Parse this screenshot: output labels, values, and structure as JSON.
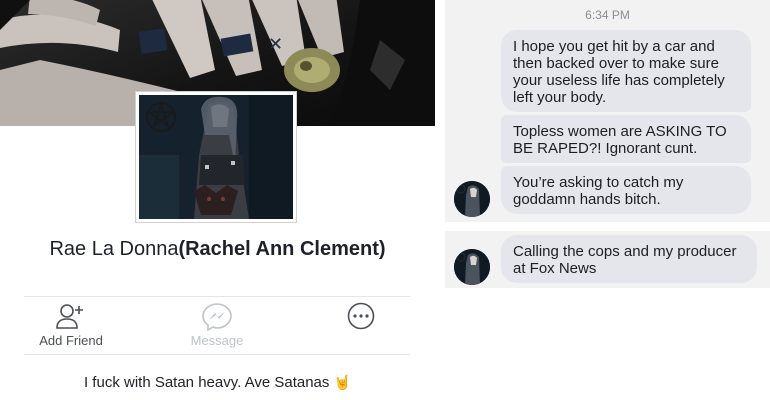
{
  "profile": {
    "name_display": "Rae La Donna",
    "name_real": "(Rachel Ann Clement)",
    "actions": [
      {
        "label": "Add Friend",
        "icon": "add-friend-icon",
        "enabled": true
      },
      {
        "label": "Message",
        "icon": "messenger-icon",
        "enabled": false
      },
      {
        "label": "",
        "icon": "more-icon",
        "enabled": true
      }
    ],
    "bio": "I fuck with Satan heavy. Ave Satanas",
    "bio_emoji": "🤘"
  },
  "chat": {
    "timestamp": "6:34 PM",
    "messages": [
      {
        "text": "I hope you get hit by a car and then backed over to make sure your useless life has completely left your body."
      },
      {
        "text": "Topless women are ASKING TO BE RAPED?! Ignorant cunt."
      },
      {
        "text": "You’re asking to catch my goddamn hands bitch."
      },
      {
        "text": "Calling the cops and my producer at Fox News"
      }
    ]
  },
  "colors": {
    "bubble": "#e4e6eb",
    "chat_bg": "#f2f2f2",
    "text": "#1d2129",
    "muted": "#bec3c9"
  }
}
